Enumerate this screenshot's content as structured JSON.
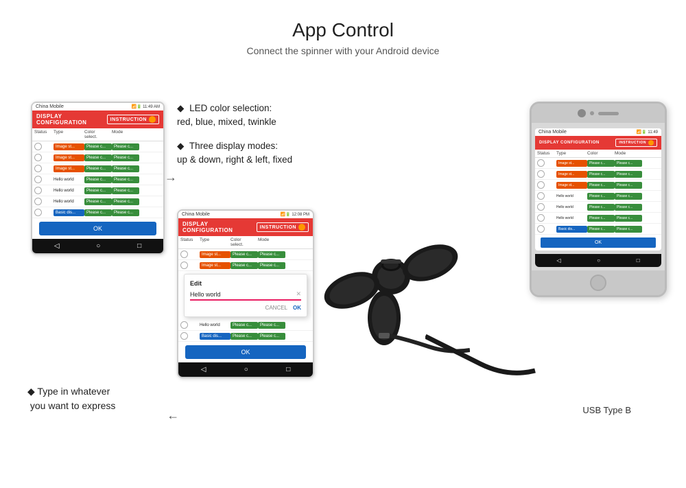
{
  "page": {
    "title": "App Control",
    "subtitle": "Connect the spinner with your Android device"
  },
  "bullets": [
    {
      "id": "b1",
      "text": "LED color selection:\nred, blue, mixed, twinkle"
    },
    {
      "id": "b2",
      "text": "Three display modes:\nup & down, right & left, fixed"
    }
  ],
  "annotation_bottom": {
    "text": "◆ Type in whatever\nyou want to express"
  },
  "usb_label": "USB Type B",
  "left_phone": {
    "carrier": "China Mobile",
    "time": "11:49 AM",
    "top_bar_label": "DISPLAY CONFIGURATION",
    "instruction_label": "INSTRUCTION",
    "col_status": "Status",
    "col_type": "Type",
    "col_color": "Color\nselection",
    "col_mode": "Mode",
    "rows": [
      {
        "type": "orange",
        "type_label": "Image st...",
        "color": "green",
        "color_label": "Please c...",
        "mode": "green",
        "mode_label": "Please c..."
      },
      {
        "type": "orange",
        "type_label": "Image st...",
        "color": "green",
        "color_label": "Please c...",
        "mode": "green",
        "mode_label": "Please c..."
      },
      {
        "type": "orange",
        "type_label": "Image st...",
        "color": "green",
        "color_label": "Please c...",
        "mode": "green",
        "mode_label": "Please c..."
      },
      {
        "type": "text",
        "type_label": "Hello world",
        "color": "green",
        "color_label": "Please c...",
        "mode": "green",
        "mode_label": "Please c..."
      },
      {
        "type": "text",
        "type_label": "Hello world",
        "color": "green",
        "color_label": "Please c...",
        "mode": "green",
        "mode_label": "Please c..."
      },
      {
        "type": "text",
        "type_label": "Hello world",
        "color": "green",
        "color_label": "Please c...",
        "mode": "green",
        "mode_label": "Please c..."
      },
      {
        "type": "blue",
        "type_label": "Basic dis...",
        "color": "green",
        "color_label": "Please c...",
        "mode": "green",
        "mode_label": "Please c..."
      }
    ],
    "ok_label": "OK"
  },
  "mid_phone": {
    "carrier": "China Mobile",
    "time": "12:08 PM",
    "top_bar_label": "DISPLAY CONFIGURATION",
    "instruction_label": "INSTRUCTION",
    "col_status": "Status",
    "col_type": "Type",
    "col_color": "Color\nselection",
    "col_mode": "Mode",
    "rows_top": [
      {
        "type": "orange",
        "type_label": "Image st...",
        "color": "green",
        "color_label": "Please c...",
        "mode": "green",
        "mode_label": "Please c..."
      },
      {
        "type": "orange",
        "type_label": "Image st...",
        "color": "green",
        "color_label": "Please c...",
        "mode": "green",
        "mode_label": "Please c..."
      }
    ],
    "dialog": {
      "title": "Edit",
      "value": "Hello world",
      "cancel": "CANCEL",
      "ok": "OK"
    },
    "rows_bottom": [
      {
        "type": "text",
        "type_label": "Hello world",
        "color": "green",
        "color_label": "Please c...",
        "mode": "green",
        "mode_label": "Please c..."
      },
      {
        "type": "blue",
        "type_label": "Basic dis...",
        "color": "green",
        "color_label": "Please c...",
        "mode": "green",
        "mode_label": "Please c..."
      }
    ],
    "ok_label": "OK"
  },
  "icons": {
    "back": "◁",
    "home": "○",
    "recent": "□",
    "diamond": "◆",
    "arrow": "→"
  }
}
